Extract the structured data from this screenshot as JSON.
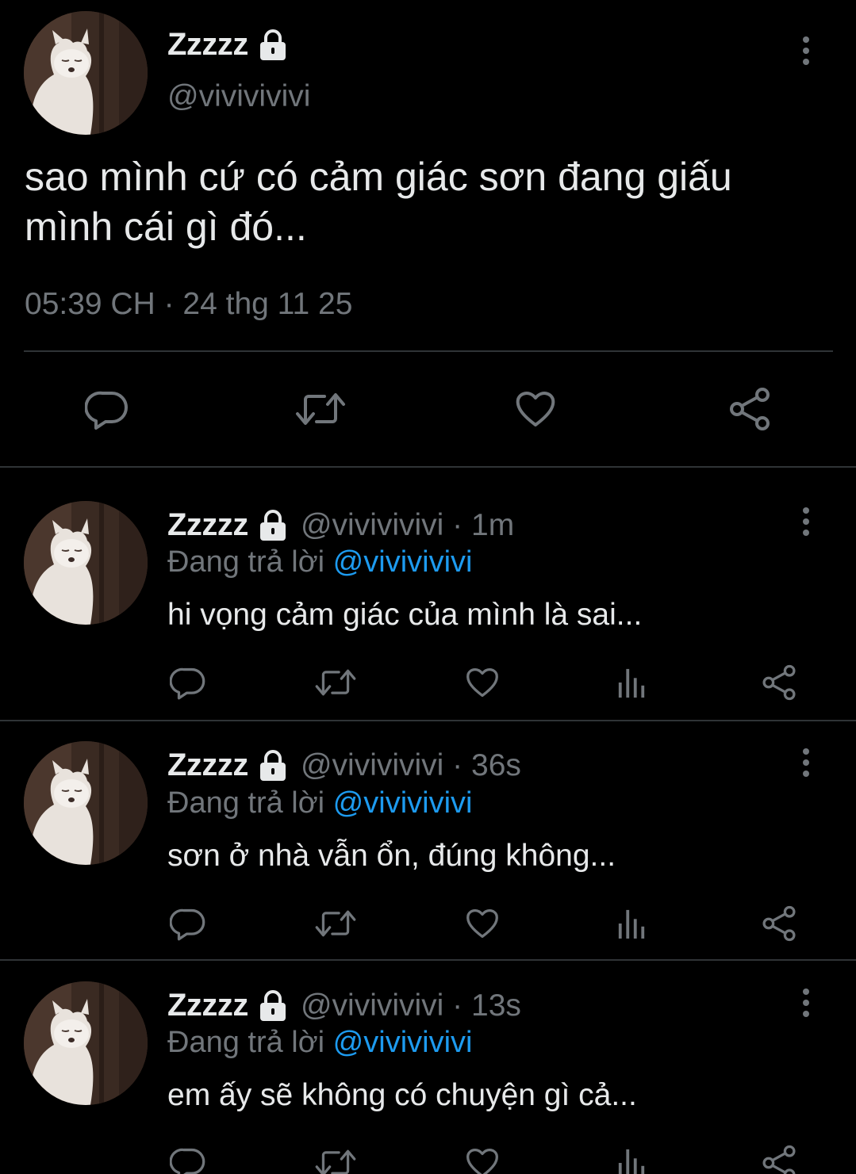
{
  "main_tweet": {
    "display_name": "Zzzzz",
    "handle": "@vivivivivi",
    "text": "sao mình cứ có cảm giác sơn đang giấu mình cái gì đó...",
    "timestamp": "05:39 CH · 24 thg 11 25"
  },
  "replies": [
    {
      "display_name": "Zzzzz",
      "meta": "@vivivivivi · 1m",
      "replying_prefix": "Đang trả lời ",
      "replying_to": "@vivivivivi",
      "text": "hi vọng cảm giác của mình là sai..."
    },
    {
      "display_name": "Zzzzz",
      "meta": "@vivivivivi · 36s",
      "replying_prefix": "Đang trả lời ",
      "replying_to": "@vivivivivi",
      "text": "sơn ở nhà vẫn ổn, đúng không..."
    },
    {
      "display_name": "Zzzzz",
      "meta": "@vivivivivi · 13s",
      "replying_prefix": "Đang trả lời ",
      "replying_to": "@vivivivivi",
      "text": "em ấy sẽ không có chuyện gì cả..."
    }
  ],
  "icons": {
    "reply": "comment-bubble-icon",
    "retweet": "retweet-icon",
    "like": "heart-icon",
    "views": "analytics-icon",
    "share": "share-icon",
    "lock": "lock-icon",
    "more": "more-vertical-icon"
  },
  "colors": {
    "background": "#000000",
    "text": "#e7e9ea",
    "secondary": "#71767b",
    "accent": "#1d9bf0",
    "divider": "#2f3336"
  }
}
